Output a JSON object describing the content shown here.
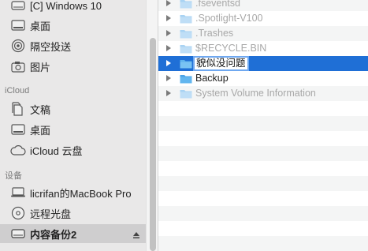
{
  "sidebar": {
    "items_top": [
      {
        "label": "[C] Windows 10",
        "icon": "drive-icon"
      },
      {
        "label": "桌面",
        "icon": "desktop-icon"
      },
      {
        "label": "隔空投送",
        "icon": "airdrop-icon"
      },
      {
        "label": "图片",
        "icon": "camera-icon"
      }
    ],
    "icloud_header": "iCloud",
    "icloud_items": [
      {
        "label": "文稿",
        "icon": "documents-icon"
      },
      {
        "label": "桌面",
        "icon": "desktop-icon"
      },
      {
        "label": "iCloud 云盘",
        "icon": "cloud-icon"
      }
    ],
    "devices_header": "设备",
    "device_items": [
      {
        "label": "licrifan的MacBook Pro",
        "icon": "laptop-icon"
      },
      {
        "label": "远程光盘",
        "icon": "disc-icon"
      },
      {
        "label": "内容备份2",
        "icon": "drive-icon",
        "selected": true
      }
    ]
  },
  "files": {
    "rows": [
      {
        "name": ".fseventsd",
        "dim": true
      },
      {
        "name": ".Spotlight-V100",
        "dim": true
      },
      {
        "name": ".Trashes",
        "dim": true
      },
      {
        "name": "$RECYCLE.BIN",
        "dim": true
      },
      {
        "name": "貌似没问题",
        "selected": true,
        "editing": true
      },
      {
        "name": "Backup",
        "dim": false
      },
      {
        "name": "System Volume Information",
        "dim": true
      }
    ]
  },
  "colors": {
    "selection": "#1f6fd6",
    "folder": "#5fb3ee",
    "folder_dim": "#a9d3f3"
  }
}
